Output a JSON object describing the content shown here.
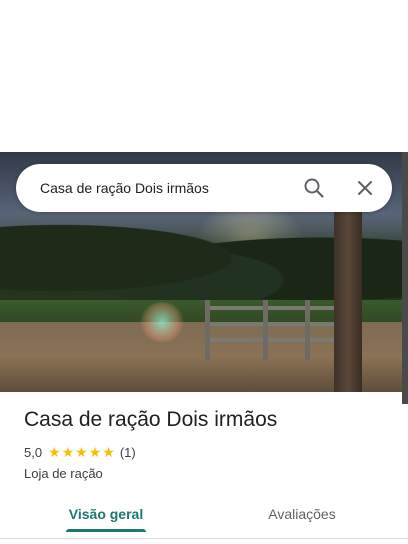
{
  "search": {
    "query": "Casa de ração Dois irmãos",
    "search_icon": "search-icon",
    "close_icon": "close-icon"
  },
  "place": {
    "name": "Casa de ração Dois irmãos",
    "rating": "5,0",
    "stars": "★★★★★",
    "review_count": "(1)",
    "category": "Loja de ração",
    "star_color": "#fbbc04"
  },
  "tabs": [
    {
      "label": "Visão geral",
      "active": true
    },
    {
      "label": "Avaliações",
      "active": false
    }
  ],
  "colors": {
    "accent": "#1a7a73"
  }
}
